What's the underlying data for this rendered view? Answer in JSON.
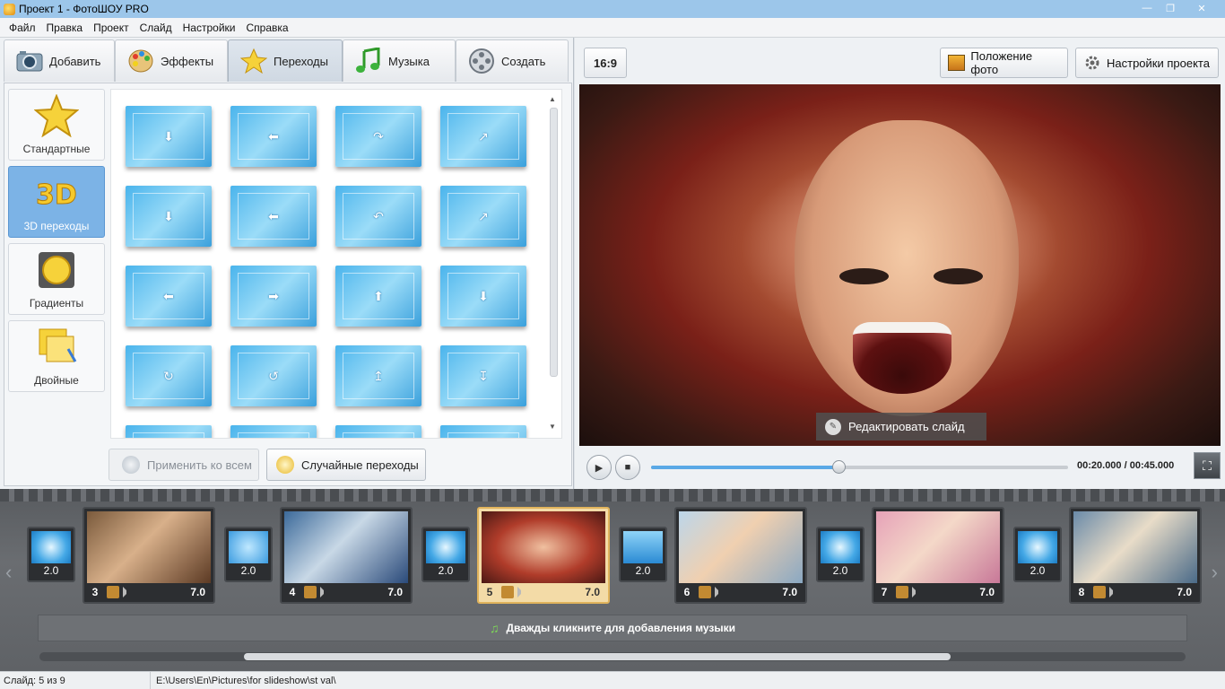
{
  "window": {
    "title": "Проект 1 - ФотоШОУ PRO",
    "min": "—",
    "max": "❐",
    "close": "✕"
  },
  "menu": [
    "Файл",
    "Правка",
    "Проект",
    "Слайд",
    "Настройки",
    "Справка"
  ],
  "tabs": [
    {
      "label": "Добавить",
      "icon": "camera-icon"
    },
    {
      "label": "Эффекты",
      "icon": "palette-icon"
    },
    {
      "label": "Переходы",
      "icon": "star-icon",
      "active": true
    },
    {
      "label": "Музыка",
      "icon": "music-icon"
    },
    {
      "label": "Создать",
      "icon": "film-reel-icon"
    }
  ],
  "categories": [
    {
      "label": "Стандартные",
      "icon": "star-icon"
    },
    {
      "label": "3D переходы",
      "icon": "3d-icon",
      "active": true
    },
    {
      "label": "Градиенты",
      "icon": "gradient-icon"
    },
    {
      "label": "Двойные",
      "icon": "double-icon"
    }
  ],
  "buttons": {
    "apply_all": "Применить ко всем",
    "random": "Случайные переходы"
  },
  "preview": {
    "ratio": "16:9",
    "photo_position": "Положение фото",
    "project_settings": "Настройки проекта",
    "edit_slide": "Редактировать слайд",
    "time": "00:20.000 / 00:45.000",
    "progress": 0.45
  },
  "timeline": {
    "slides": [
      {
        "num": "3",
        "duration": "7.0"
      },
      {
        "num": "4",
        "duration": "7.0"
      },
      {
        "num": "5",
        "duration": "7.0",
        "active": true
      },
      {
        "num": "6",
        "duration": "7.0"
      },
      {
        "num": "7",
        "duration": "7.0"
      },
      {
        "num": "8",
        "duration": "7.0"
      }
    ],
    "transitions": [
      "2.0",
      "2.0",
      "2.0",
      "2.0",
      "2.0",
      "2.0"
    ],
    "music_hint": "Дважды кликните для добавления музыки"
  },
  "status": {
    "slide": "Слайд: 5 из 9",
    "path": "E:\\Users\\En\\Pictures\\for slideshow\\st val\\"
  },
  "colors": {
    "accent": "#5aa9e6",
    "active_category": "#7cb3e6",
    "active_slide": "#e0b35c"
  }
}
